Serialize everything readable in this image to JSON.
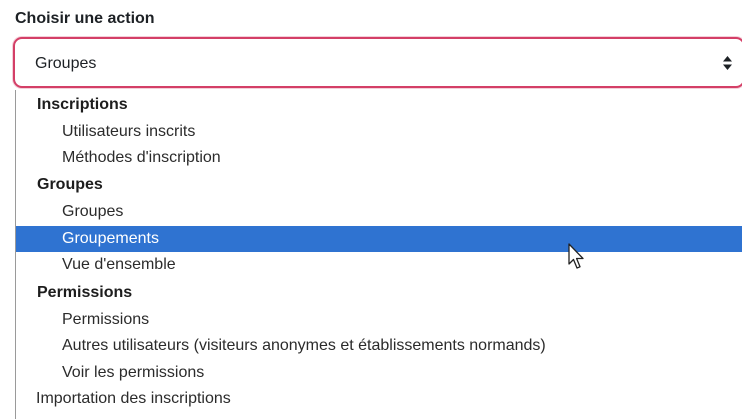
{
  "form": {
    "label": "Choisir une action",
    "selected_value": "Groupes"
  },
  "dropdown": {
    "items": [
      {
        "kind": "group",
        "label": "Inscriptions"
      },
      {
        "kind": "option",
        "label": "Utilisateurs inscrits"
      },
      {
        "kind": "option",
        "label": "Méthodes d'inscription"
      },
      {
        "kind": "group",
        "label": "Groupes"
      },
      {
        "kind": "option",
        "label": "Groupes"
      },
      {
        "kind": "option",
        "label": "Groupements",
        "highlighted": true
      },
      {
        "kind": "option",
        "label": "Vue d'ensemble"
      },
      {
        "kind": "group",
        "label": "Permissions"
      },
      {
        "kind": "option",
        "label": "Permissions"
      },
      {
        "kind": "option",
        "label": "Autres utilisateurs (visiteurs anonymes et établissements normands)"
      },
      {
        "kind": "option",
        "label": "Voir les permissions"
      },
      {
        "kind": "top",
        "label": "Importation des inscriptions"
      }
    ]
  },
  "colors": {
    "focus_border": "#d43f67",
    "highlight": "#2f73d1"
  },
  "icons": {
    "select_arrows": "updown-arrows-icon",
    "cursor": "mouse-pointer-icon"
  }
}
